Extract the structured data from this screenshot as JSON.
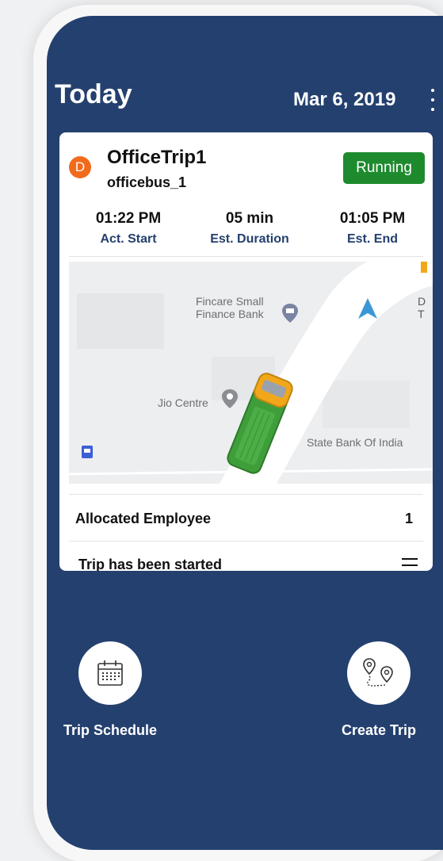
{
  "header": {
    "title": "Today",
    "date": "Mar 6, 2019"
  },
  "trip_card": {
    "avatar_letter": "D",
    "trip_name": "OfficeTrip1",
    "bus_name": "officebus_1",
    "status": "Running",
    "stats": [
      {
        "value": "01:22 PM",
        "label": "Act. Start"
      },
      {
        "value": "05 min",
        "label": "Est. Duration"
      },
      {
        "value": "01:05 PM",
        "label": "Est. End"
      }
    ],
    "map": {
      "labels": [
        "Fincare Small",
        "Finance Bank",
        "Jio Centre",
        "State Bank Of India",
        "D",
        "T"
      ]
    },
    "allocated_label": "Allocated Employee",
    "allocated_count": "1",
    "status_message": "Trip has been started"
  },
  "actions": {
    "schedule_label": "Trip Schedule",
    "create_label": "Create Trip"
  },
  "colors": {
    "background": "#24406f",
    "status_green": "#1e8a2e",
    "avatar_orange": "#f26b1d",
    "bus_green": "#3f9e3a",
    "bus_yellow": "#f2a71b"
  },
  "icons": {
    "menu": "kebab-menu-icon",
    "schedule": "calendar-icon",
    "create": "route-pin-icon",
    "list": "hamburger-menu-icon"
  }
}
